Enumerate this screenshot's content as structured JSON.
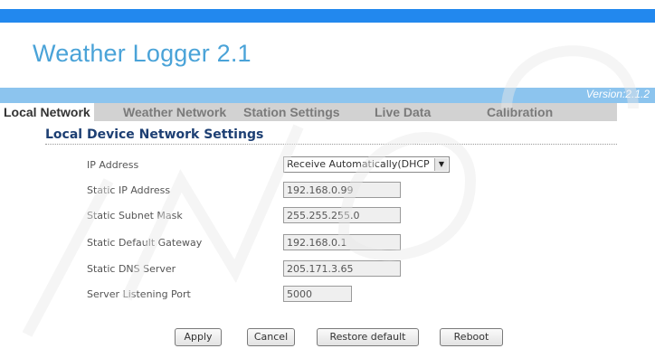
{
  "app_title": "Weather Logger 2.1",
  "version": "Version:2.1.2",
  "tabs": [
    {
      "label": "Local Network"
    },
    {
      "label": "Weather Network"
    },
    {
      "label": "Station Settings"
    },
    {
      "label": "Live Data"
    },
    {
      "label": "Calibration"
    }
  ],
  "section_title": "Local Device Network Settings",
  "fields": {
    "ip_address": {
      "label": "IP Address",
      "value": "Receive Automatically(DHCP"
    },
    "static_ip": {
      "label": "Static IP Address",
      "value": "192.168.0.99"
    },
    "subnet_mask": {
      "label": "Static Subnet Mask",
      "value": "255.255.255.0"
    },
    "gateway": {
      "label": "Static Default Gateway",
      "value": "192.168.0.1"
    },
    "dns": {
      "label": "Static DNS Server",
      "value": "205.171.3.65"
    },
    "port": {
      "label": "Server Listening Port",
      "value": "5000"
    }
  },
  "buttons": {
    "apply": "Apply",
    "cancel": "Cancel",
    "restore": "Restore default",
    "reboot": "Reboot"
  },
  "colors": {
    "top_bar": "#2288ee",
    "title": "#4aa3d8",
    "version_strip": "#8cc4ee",
    "tab_bar": "#d2d2d2",
    "section_title": "#1d3f73"
  }
}
